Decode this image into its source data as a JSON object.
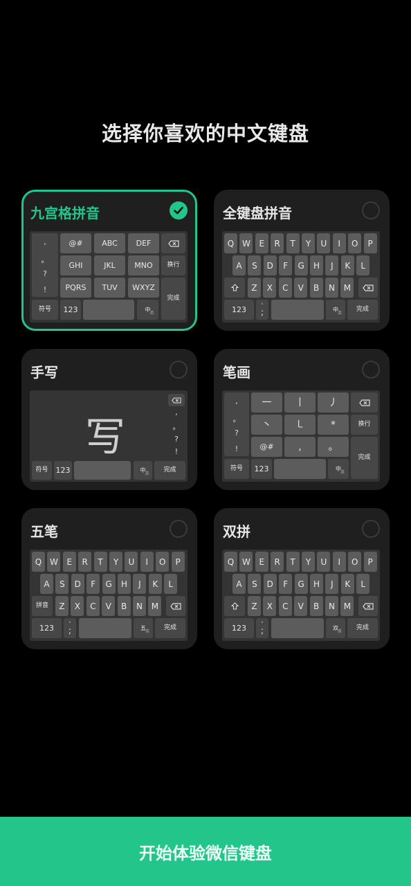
{
  "page": {
    "title": "选择你喜欢的中文键盘",
    "start_button": "开始体验微信键盘",
    "accent": "#22c68a"
  },
  "cards": {
    "nine": {
      "title": "九宫格拼音",
      "selected": true
    },
    "full": {
      "title": "全键盘拼音",
      "selected": false
    },
    "hand": {
      "title": "手写",
      "selected": false
    },
    "stroke": {
      "title": "笔画",
      "selected": false
    },
    "wubi": {
      "title": "五笔",
      "selected": false
    },
    "shuang": {
      "title": "双拼",
      "selected": false
    }
  },
  "keys": {
    "nine_grid": [
      "@#",
      "ABC",
      "DEF",
      "GHI",
      "JKL",
      "MNO",
      "PQRS",
      "TUV",
      "WXYZ"
    ],
    "nine_side": [
      ",",
      "。",
      "?",
      "!"
    ],
    "row1": [
      "Q",
      "W",
      "E",
      "R",
      "T",
      "Y",
      "U",
      "I",
      "O",
      "P"
    ],
    "row2": [
      "A",
      "S",
      "D",
      "F",
      "G",
      "H",
      "J",
      "K",
      "L"
    ],
    "row3": [
      "Z",
      "X",
      "C",
      "V",
      "B",
      "N",
      "M"
    ],
    "stroke_keys": [
      "一",
      "丨",
      "丿",
      "丶",
      "㇄",
      "*",
      "@#",
      ",",
      "。"
    ],
    "fuhao": "符号",
    "num": "123",
    "huanhang": "换行",
    "wancheng": "完成",
    "pinyin": "拼音",
    "zh": "中",
    "zh_sub": "英",
    "wu": "五",
    "shuang": "双",
    "hand_char": "写",
    "hand_side": [
      ",",
      "。",
      "?",
      "!"
    ],
    "comma_top": "°",
    "comma": ";"
  },
  "icons": {
    "backspace": "backspace-icon",
    "shift": "shift-icon",
    "check": "check-icon"
  }
}
